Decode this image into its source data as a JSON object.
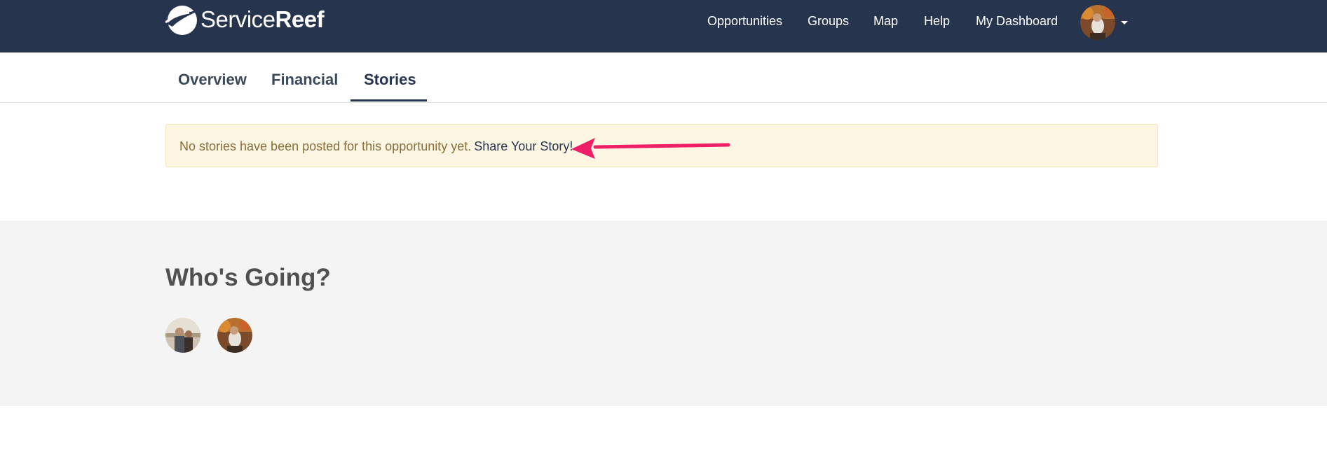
{
  "brand": {
    "name_part1": "Service",
    "name_part2": "Reef"
  },
  "nav": {
    "links": [
      "Opportunities",
      "Groups",
      "Map",
      "Help",
      "My Dashboard"
    ]
  },
  "tabs": [
    "Overview",
    "Financial",
    "Stories"
  ],
  "active_tab": "Stories",
  "alert": {
    "message": "No stories have been posted for this opportunity yet.",
    "link_label": "Share Your Story!"
  },
  "going": {
    "title": "Who's Going?"
  },
  "colors": {
    "navbar": "#26354d",
    "alert_bg": "#fcf6e3",
    "alert_text": "#8a6d3b",
    "arrow": "#ee1f66",
    "section_bg": "#f4f4f4"
  },
  "icons": [
    "logo-mark-icon",
    "caret-down-icon",
    "annotation-arrow-icon"
  ]
}
